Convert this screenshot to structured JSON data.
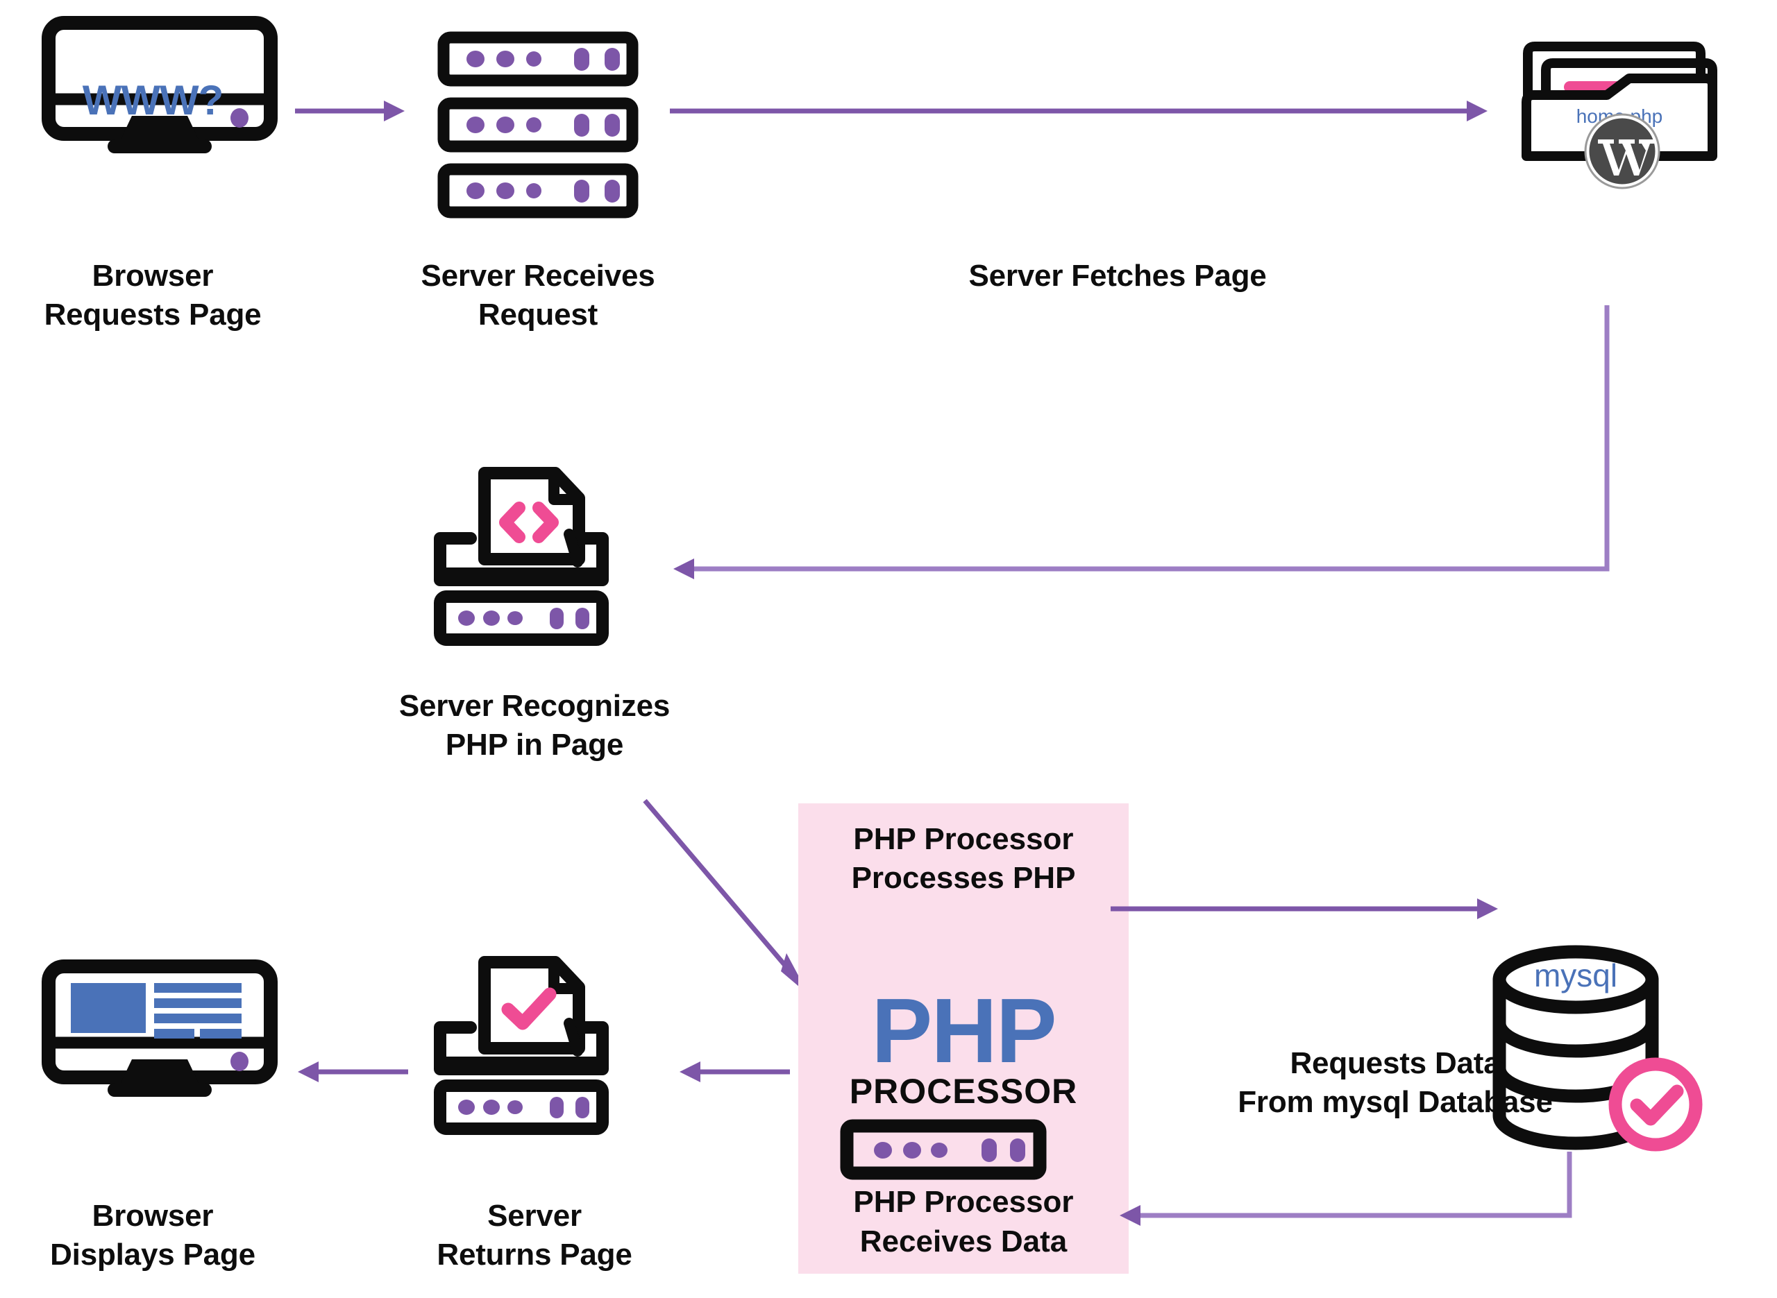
{
  "diagram": {
    "title_text_color": "#0d0d0d",
    "colors": {
      "ink": "#0d0d0d",
      "accent_purple": "#7d56a8",
      "accent_blue": "#4a72b8",
      "accent_pink": "#ef4c94",
      "panel_pink": "#fbdeeb",
      "wordpress_gray": "#4a4a4a"
    },
    "steps": [
      {
        "id": "browser-request",
        "label": "Browser\nRequests Page",
        "icon": "monitor-www-icon"
      },
      {
        "id": "server-receives",
        "label": "Server Receives\nRequest",
        "icon": "server-rack-icon"
      },
      {
        "id": "server-fetches",
        "label": "Server Fetches Page",
        "icon": "none"
      },
      {
        "id": "wordpress-folder",
        "label": "",
        "icon": "folder-wordpress-icon"
      },
      {
        "id": "server-recognizes",
        "label": "Server Recognizes\nPHP in Page",
        "icon": "server-code-doc-icon"
      },
      {
        "id": "php-processes",
        "label": "PHP Processor\nProcesses PHP",
        "icon": "none"
      },
      {
        "id": "php-receives",
        "label": "PHP Processor\nReceives Data",
        "icon": "none"
      },
      {
        "id": "requests-data",
        "label": "Requests Data\nFrom mysql Database",
        "icon": "none"
      },
      {
        "id": "server-returns",
        "label": "Server\nReturns Page",
        "icon": "server-check-doc-icon"
      },
      {
        "id": "browser-displays",
        "label": "Browser\nDisplays Page",
        "icon": "monitor-page-icon"
      }
    ],
    "monitor_screen_text": "WWW?",
    "folder_file_label": "home.php",
    "database_label": "mysql",
    "php_processor": {
      "top_label": "PHP Processor\nProcesses PHP",
      "logo_word": "PHP",
      "logo_sub": "PROCESSOR",
      "bottom_label": "PHP Processor\nReceives Data"
    },
    "icon_names": [
      "monitor-www-icon",
      "server-rack-icon",
      "folder-wordpress-icon",
      "wordpress-logo-icon",
      "server-code-doc-icon",
      "code-brackets-icon",
      "php-server-unit-icon",
      "database-mysql-icon",
      "check-circle-icon",
      "server-check-doc-icon",
      "check-mark-icon",
      "monitor-page-icon",
      "arrow-right-icon",
      "arrow-left-icon",
      "arrow-diagonal-icon",
      "elbow-connector-icon"
    ]
  }
}
